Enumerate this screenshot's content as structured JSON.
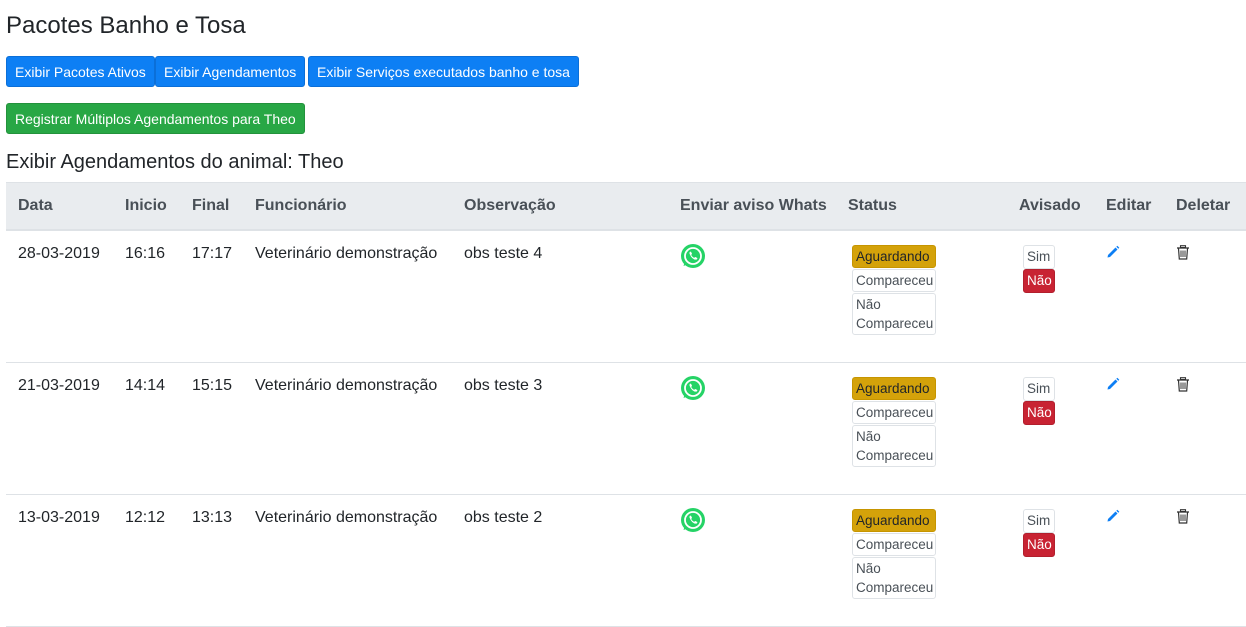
{
  "page_title": "Pacotes Banho e Tosa",
  "buttons": {
    "ativos": "Exibir Pacotes Ativos",
    "agendamentos": "Exibir Agendamentos",
    "servicos": "Exibir Serviços executados banho e tosa",
    "registrar": "Registrar Múltiplos Agendamentos para Theo"
  },
  "section_title": "Exibir Agendamentos do animal: Theo",
  "table": {
    "headers": {
      "data": "Data",
      "inicio": "Inicio",
      "final": "Final",
      "funcionario": "Funcionário",
      "observacao": "Observação",
      "whats": "Enviar aviso Whats",
      "status": "Status",
      "avisado": "Avisado",
      "editar": "Editar",
      "deletar": "Deletar"
    },
    "status_options": [
      "Aguardando",
      "Compareceu",
      "Não Compareceu"
    ],
    "avisado_options": [
      "Sim",
      "Não"
    ],
    "rows": [
      {
        "data": "28-03-2019",
        "inicio": "16:16",
        "final": "17:17",
        "funcionario": "Veterinário demonstração",
        "observacao": "obs teste 4"
      },
      {
        "data": "21-03-2019",
        "inicio": "14:14",
        "final": "15:15",
        "funcionario": "Veterinário demonstração",
        "observacao": "obs teste 3"
      },
      {
        "data": "13-03-2019",
        "inicio": "12:12",
        "final": "13:13",
        "funcionario": "Veterinário demonstração",
        "observacao": "obs teste 2"
      }
    ]
  },
  "colors": {
    "primary": "#0d7ff4",
    "success": "#28a745",
    "warning": "#d4a20a",
    "danger": "#c82333",
    "whatsapp": "#25d366",
    "edit_icon": "#0d7ff4"
  },
  "icons": {
    "whats": "whatsapp-icon",
    "edit": "pencil-icon",
    "delete": "trash-icon"
  }
}
